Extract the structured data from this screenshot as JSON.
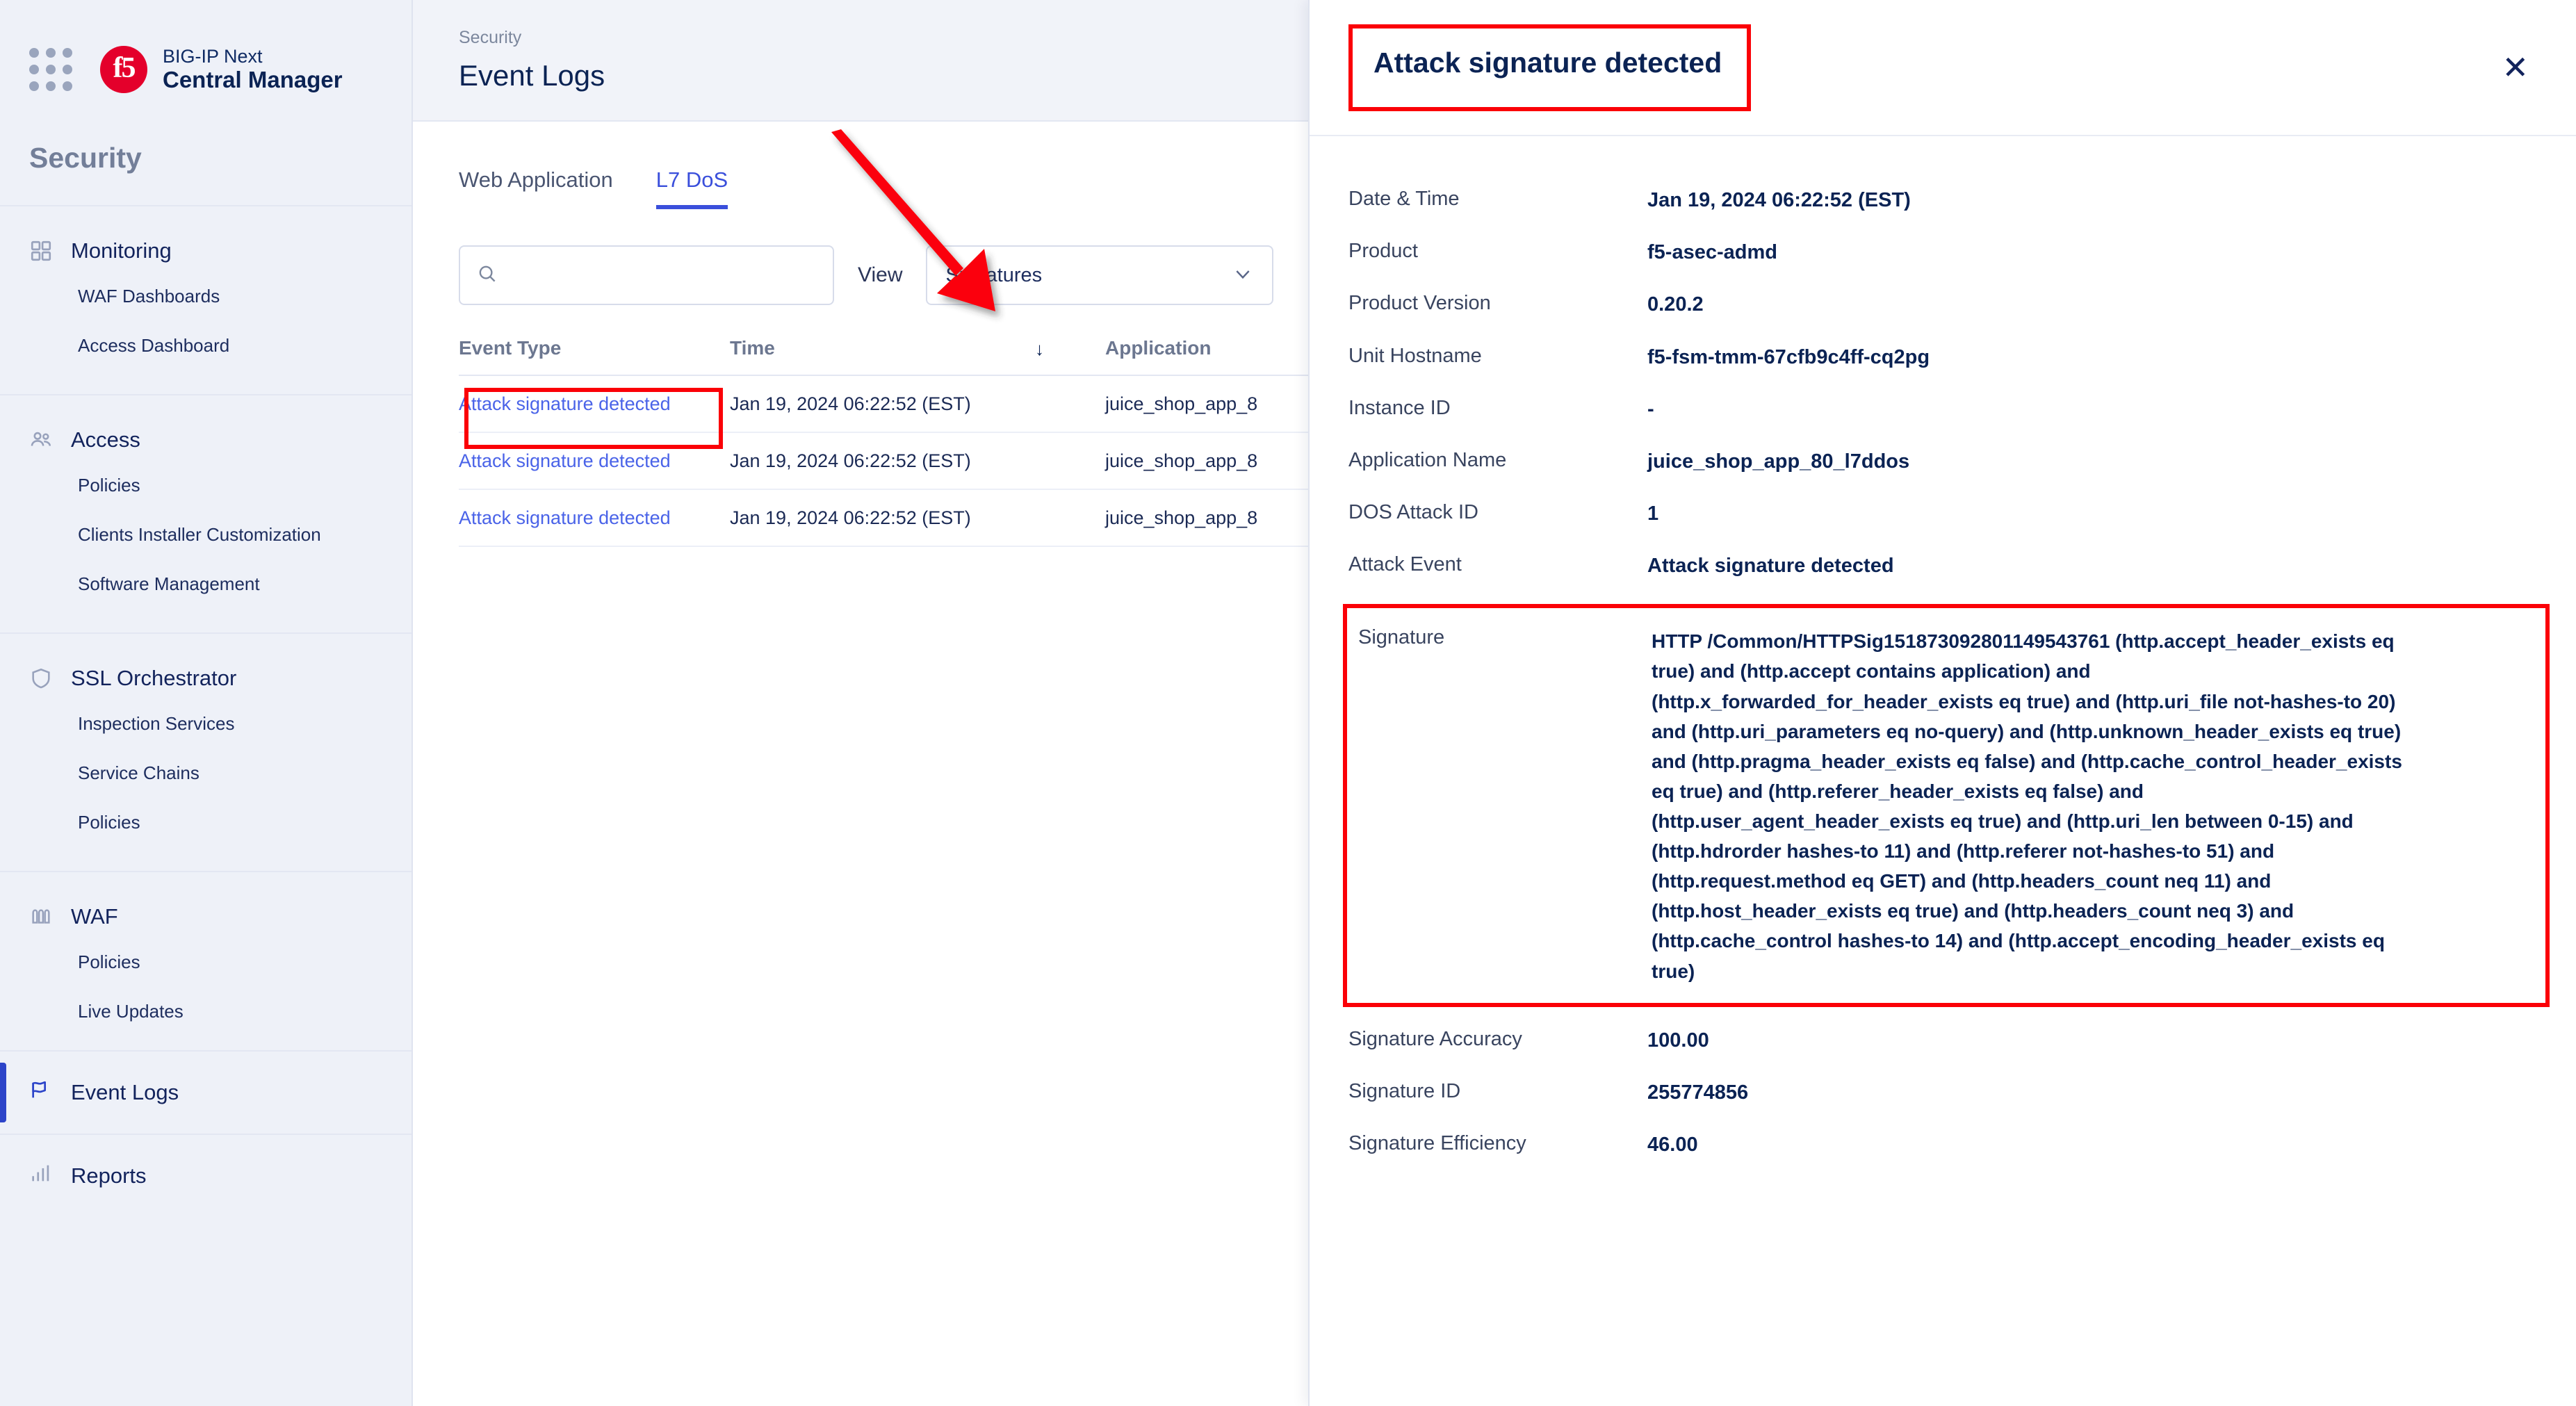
{
  "brand": {
    "logo_text": "f5",
    "line1": "BIG-IP Next",
    "line2": "Central Manager",
    "apps_icon": "apps-grid-icon"
  },
  "sidebar": {
    "title": "Security",
    "groups": [
      {
        "label": "Monitoring",
        "icon": "dashboard-grid-icon",
        "children": [
          {
            "label": "WAF Dashboards"
          },
          {
            "label": "Access Dashboard"
          }
        ]
      },
      {
        "label": "Access",
        "icon": "users-icon",
        "children": [
          {
            "label": "Policies"
          },
          {
            "label": "Clients Installer Customization"
          },
          {
            "label": "Software Management"
          }
        ]
      },
      {
        "label": "SSL Orchestrator",
        "icon": "shield-icon",
        "children": [
          {
            "label": "Inspection Services"
          },
          {
            "label": "Service Chains"
          },
          {
            "label": "Policies"
          }
        ]
      },
      {
        "label": "WAF",
        "icon": "wall-icon",
        "children": [
          {
            "label": "Policies"
          },
          {
            "label": "Live Updates"
          }
        ]
      }
    ],
    "singles": [
      {
        "label": "Event Logs",
        "icon": "flag-icon",
        "active": true
      },
      {
        "label": "Reports",
        "icon": "bar-chart-icon",
        "active": false
      }
    ]
  },
  "header": {
    "breadcrumb": "Security",
    "title": "Event Logs"
  },
  "tabs": [
    {
      "label": "Web Application",
      "active": false
    },
    {
      "label": "L7 DoS",
      "active": true
    }
  ],
  "filters": {
    "search_value": "",
    "search_placeholder": "",
    "search_icon": "search-icon",
    "view_label": "View",
    "view_selected": "Signatures",
    "view_chevron": "chevron-down-icon"
  },
  "table": {
    "columns": [
      "Event Type",
      "Time",
      "Application"
    ],
    "sort_indicator": "sort-descending-arrow",
    "rows": [
      {
        "event_type": "Attack signature detected",
        "time": "Jan 19, 2024 06:22:52 (EST)",
        "application": "juice_shop_app_8"
      },
      {
        "event_type": "Attack signature detected",
        "time": "Jan 19, 2024 06:22:52 (EST)",
        "application": "juice_shop_app_8"
      },
      {
        "event_type": "Attack signature detected",
        "time": "Jan 19, 2024 06:22:52 (EST)",
        "application": "juice_shop_app_8"
      }
    ]
  },
  "detail": {
    "title": "Attack signature detected",
    "close_icon": "close-icon",
    "fields_top": [
      {
        "label": "Date & Time",
        "value": "Jan 19, 2024 06:22:52 (EST)"
      },
      {
        "label": "Product",
        "value": "f5-asec-admd"
      },
      {
        "label": "Product Version",
        "value": "0.20.2"
      },
      {
        "label": "Unit Hostname",
        "value": "f5-fsm-tmm-67cfb9c4ff-cq2pg"
      },
      {
        "label": "Instance ID",
        "value": "-"
      },
      {
        "label": "Application Name",
        "value": "juice_shop_app_80_l7ddos"
      },
      {
        "label": "DOS Attack ID",
        "value": "1"
      },
      {
        "label": "Attack Event",
        "value": "Attack signature detected"
      }
    ],
    "signature": {
      "label": "Signature",
      "value": "HTTP /Common/HTTPSig151873092801149543761 (http.accept_header_exists eq true) and (http.accept contains application) and (http.x_forwarded_for_header_exists eq true) and (http.uri_file not-hashes-to 20) and (http.uri_parameters eq no-query) and (http.unknown_header_exists eq true) and (http.pragma_header_exists eq false) and (http.cache_control_header_exists eq true) and (http.referer_header_exists eq false) and (http.user_agent_header_exists eq true) and (http.uri_len between 0-15) and (http.hdrorder hashes-to 11) and (http.referer not-hashes-to 51) and (http.request.method eq GET) and (http.headers_count neq 11) and (http.host_header_exists eq true) and (http.headers_count neq 3) and (http.cache_control hashes-to 14) and (http.accept_encoding_header_exists eq true)"
    },
    "fields_bottom": [
      {
        "label": "Signature Accuracy",
        "value": "100.00"
      },
      {
        "label": "Signature ID",
        "value": "255774856"
      },
      {
        "label": "Signature Efficiency",
        "value": "46.00"
      }
    ]
  },
  "annotations": {
    "arrow_color": "#fb0007",
    "highlight_color": "#fb0007"
  }
}
